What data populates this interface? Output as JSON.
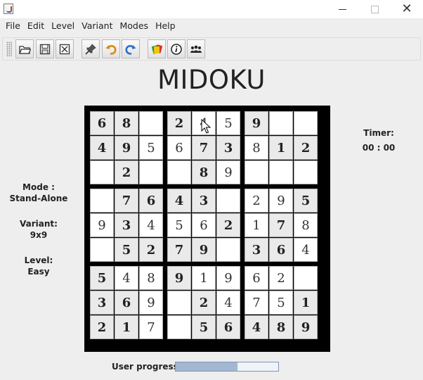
{
  "window": {
    "close_glyph": "✕"
  },
  "menubar": {
    "items": [
      "File",
      "Edit",
      "Level",
      "Variant",
      "Modes",
      "Help"
    ]
  },
  "toolbar": {
    "buttons": [
      {
        "name": "open-button",
        "icon": "folder-icon"
      },
      {
        "name": "save-button",
        "icon": "floppy-disk-icon"
      },
      {
        "name": "close-game-button",
        "icon": "close-box-icon"
      },
      {
        "name": "hint-button",
        "icon": "pin-icon"
      },
      {
        "name": "undo-button",
        "icon": "undo-arrow-icon"
      },
      {
        "name": "redo-button",
        "icon": "redo-arrow-icon"
      },
      {
        "name": "cards-button",
        "icon": "cards-icon"
      },
      {
        "name": "about-button",
        "icon": "info-icon"
      },
      {
        "name": "players-button",
        "icon": "people-icon"
      }
    ]
  },
  "game": {
    "title": "MIDOKU",
    "mode_label": "Mode :",
    "mode_value": "Stand-Alone",
    "variant_label": "Variant:",
    "variant_value": "9x9",
    "level_label": "Level:",
    "level_value": "Easy",
    "timer_label": "Timer:",
    "timer_value": "00 : 00",
    "progress_label": "User progress:",
    "progress_fraction": 0.6
  },
  "board": {
    "size": 9,
    "rows": [
      [
        "6",
        "8",
        "",
        "2",
        "4",
        "5",
        "9",
        "",
        ""
      ],
      [
        "4",
        "9",
        "5",
        "6",
        "7",
        "3",
        "8",
        "1",
        "2"
      ],
      [
        "",
        "2",
        "",
        "",
        "8",
        "9",
        "",
        "",
        ""
      ],
      [
        "",
        "7",
        "6",
        "4",
        "3",
        "",
        "2",
        "9",
        "5"
      ],
      [
        "9",
        "3",
        "4",
        "5",
        "6",
        "2",
        "1",
        "7",
        "8"
      ],
      [
        "",
        "5",
        "2",
        "7",
        "9",
        "",
        "3",
        "6",
        "4"
      ],
      [
        "5",
        "4",
        "8",
        "9",
        "1",
        "9",
        "6",
        "2",
        ""
      ],
      [
        "3",
        "6",
        "9",
        "",
        "2",
        "4",
        "7",
        "5",
        "1"
      ],
      [
        "2",
        "1",
        "7",
        "",
        "5",
        "6",
        "4",
        "8",
        "9"
      ]
    ],
    "given": [
      [
        1,
        1,
        0,
        1,
        0,
        0,
        1,
        0,
        0
      ],
      [
        1,
        1,
        0,
        0,
        1,
        1,
        0,
        1,
        1
      ],
      [
        0,
        1,
        0,
        0,
        1,
        0,
        0,
        0,
        0
      ],
      [
        0,
        1,
        1,
        1,
        1,
        0,
        0,
        0,
        1
      ],
      [
        0,
        1,
        0,
        0,
        0,
        1,
        0,
        1,
        0
      ],
      [
        0,
        1,
        1,
        1,
        1,
        0,
        1,
        1,
        0
      ],
      [
        1,
        0,
        0,
        1,
        0,
        0,
        0,
        0,
        0
      ],
      [
        1,
        1,
        0,
        0,
        1,
        0,
        0,
        0,
        1
      ],
      [
        1,
        1,
        0,
        0,
        1,
        1,
        1,
        1,
        1
      ]
    ]
  }
}
